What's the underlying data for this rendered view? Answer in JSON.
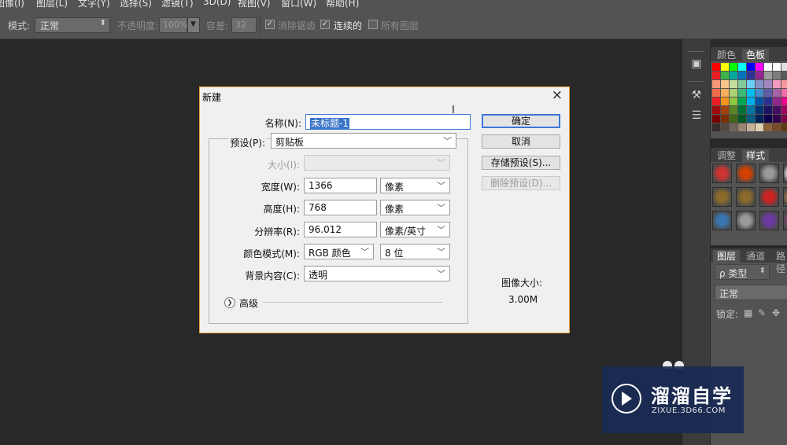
{
  "menu": [
    "图像(I)",
    "图层(L)",
    "文字(Y)",
    "选择(S)",
    "滤镜(T)",
    "3D(D)",
    "视图(V)",
    "窗口(W)",
    "帮助(H)"
  ],
  "options": {
    "mode_label": "模式:",
    "mode_value": "正常",
    "opacity_label": "不透明度:",
    "opacity_value": "100%",
    "tolerance_label": "容差:",
    "tolerance_value": "32",
    "antialias_label": "消除锯齿",
    "antialias_checked": true,
    "contiguous_label": "连续的",
    "contiguous_checked": true,
    "all_layers_label": "所有图层",
    "all_layers_checked": false
  },
  "panels": {
    "color_tabs": [
      "颜色",
      "色板"
    ],
    "style_tabs": [
      "调整",
      "样式"
    ],
    "layer_tabs": [
      "图层",
      "通道",
      "路径"
    ],
    "layer_filter": "ρ 类型",
    "blend_mode": "正常",
    "lock_label": "锁定:",
    "swatch_colors": [
      [
        "#ff0000",
        "#ffff00",
        "#00ff00",
        "#00ffff",
        "#0000ff",
        "#ff00ff",
        "#ffffff",
        "#ffffff",
        "#e0e0e0"
      ],
      [
        "#ec1c24",
        "#39b54a",
        "#00a99d",
        "#0072bc",
        "#2e3192",
        "#92278f",
        "#9e9e9e",
        "#7d7d7d",
        "#5a5a5a"
      ],
      [
        "#f7977a",
        "#fdc68a",
        "#c4df9b",
        "#82ca9c",
        "#6dcff6",
        "#8393ca",
        "#a187be",
        "#f49ac1",
        "#f5989d"
      ],
      [
        "#f26c4f",
        "#fbaf5d",
        "#acd373",
        "#3cb878",
        "#00bff3",
        "#448ccb",
        "#605ca8",
        "#a763a8",
        "#f06eaa"
      ],
      [
        "#ed1c24",
        "#f7941d",
        "#8dc63f",
        "#00a651",
        "#00aeef",
        "#0054a6",
        "#2e3192",
        "#92278f",
        "#ec008c"
      ],
      [
        "#9e0b0f",
        "#a0410d",
        "#598527",
        "#007236",
        "#0076a3",
        "#003471",
        "#1b1464",
        "#440e62",
        "#9e005d"
      ],
      [
        "#790000",
        "#7b2e00",
        "#406618",
        "#005826",
        "#005b7f",
        "#002157",
        "#0d004c",
        "#32004b",
        "#7b0046"
      ],
      [
        "#362f2d",
        "#534741",
        "#736357",
        "#998675",
        "#c7b299",
        "#e1d1b3",
        "#8c6239",
        "#754c24",
        "#603913"
      ]
    ],
    "style_cells": [
      [
        "#cc3333",
        "#d44000",
        "#9a9a9a",
        "#ffffff"
      ],
      [
        "#8a6a2a",
        "#8a6a2a",
        "#cc2222",
        "#c08040"
      ],
      [
        "#3a76b0",
        "#9a9a9a",
        "#6a3aa0",
        "#884488"
      ]
    ]
  },
  "dialog": {
    "title": "新建",
    "name_label": "名称(N):",
    "name_value": "未标题-1",
    "preset_label": "预设(P):",
    "preset_value": "剪贴板",
    "size_label": "大小(I):",
    "size_value": "",
    "width_label": "宽度(W):",
    "width_value": "1366",
    "width_unit": "像素",
    "height_label": "高度(H):",
    "height_value": "768",
    "height_unit": "像素",
    "resolution_label": "分辨率(R):",
    "resolution_value": "96.012",
    "resolution_unit": "像素/英寸",
    "color_mode_label": "颜色模式(M):",
    "color_mode_value": "RGB 颜色",
    "bit_depth": "8 位",
    "background_label": "背景内容(C):",
    "background_value": "透明",
    "advanced_label": "高级",
    "ok_label": "确定",
    "cancel_label": "取消",
    "save_preset_label": "存储预设(S)...",
    "delete_preset_label": "删除预设(D)...",
    "image_size_label": "图像大小:",
    "image_size_value": "3.00M"
  },
  "watermark": {
    "title": "溜溜自学",
    "url": "ZIXUE.3D66.COM"
  }
}
